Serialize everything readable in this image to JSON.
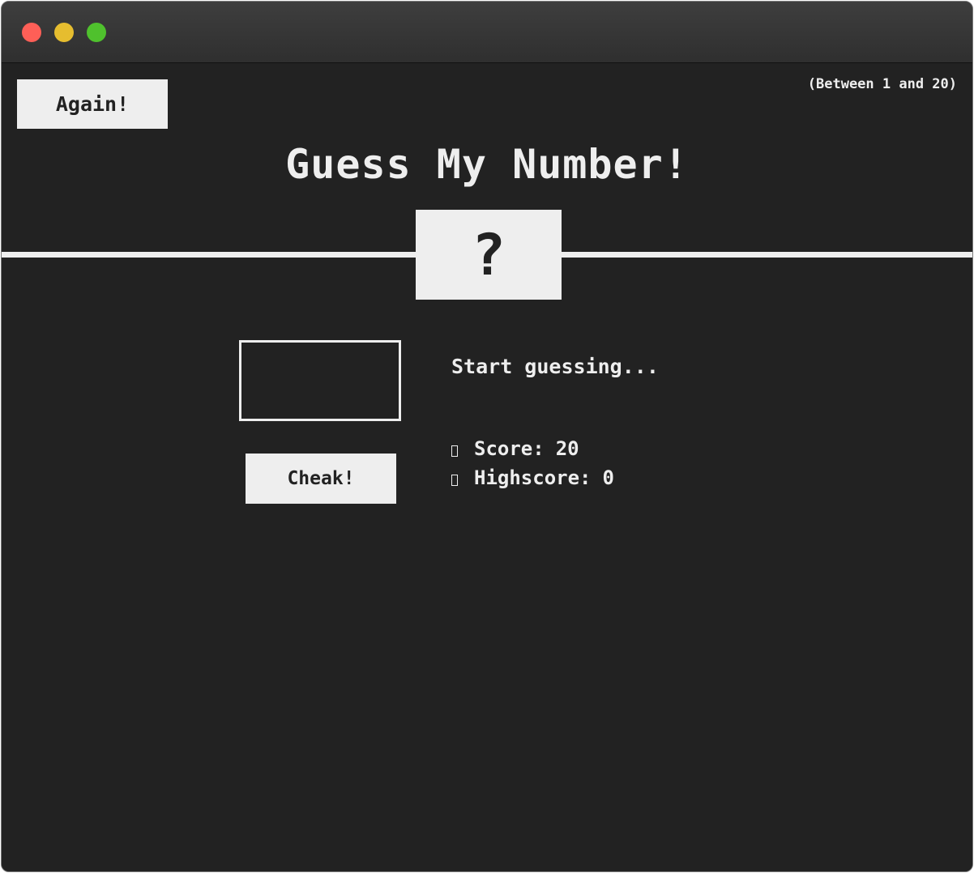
{
  "window": {
    "traffic_lights": [
      "close",
      "minimize",
      "zoom"
    ]
  },
  "header": {
    "again_label": "Again!",
    "range_hint": "(Between 1 and 20)",
    "title": "Guess My Number!"
  },
  "secret": {
    "display": "?"
  },
  "guess": {
    "value": "",
    "check_label": "Cheak!"
  },
  "status": {
    "message": "Start guessing...",
    "score_label": "Score:",
    "score_value": "20",
    "highscore_label": "Highscore:",
    "highscore_value": "0"
  },
  "colors": {
    "background": "#222222",
    "foreground": "#eeeeee"
  }
}
